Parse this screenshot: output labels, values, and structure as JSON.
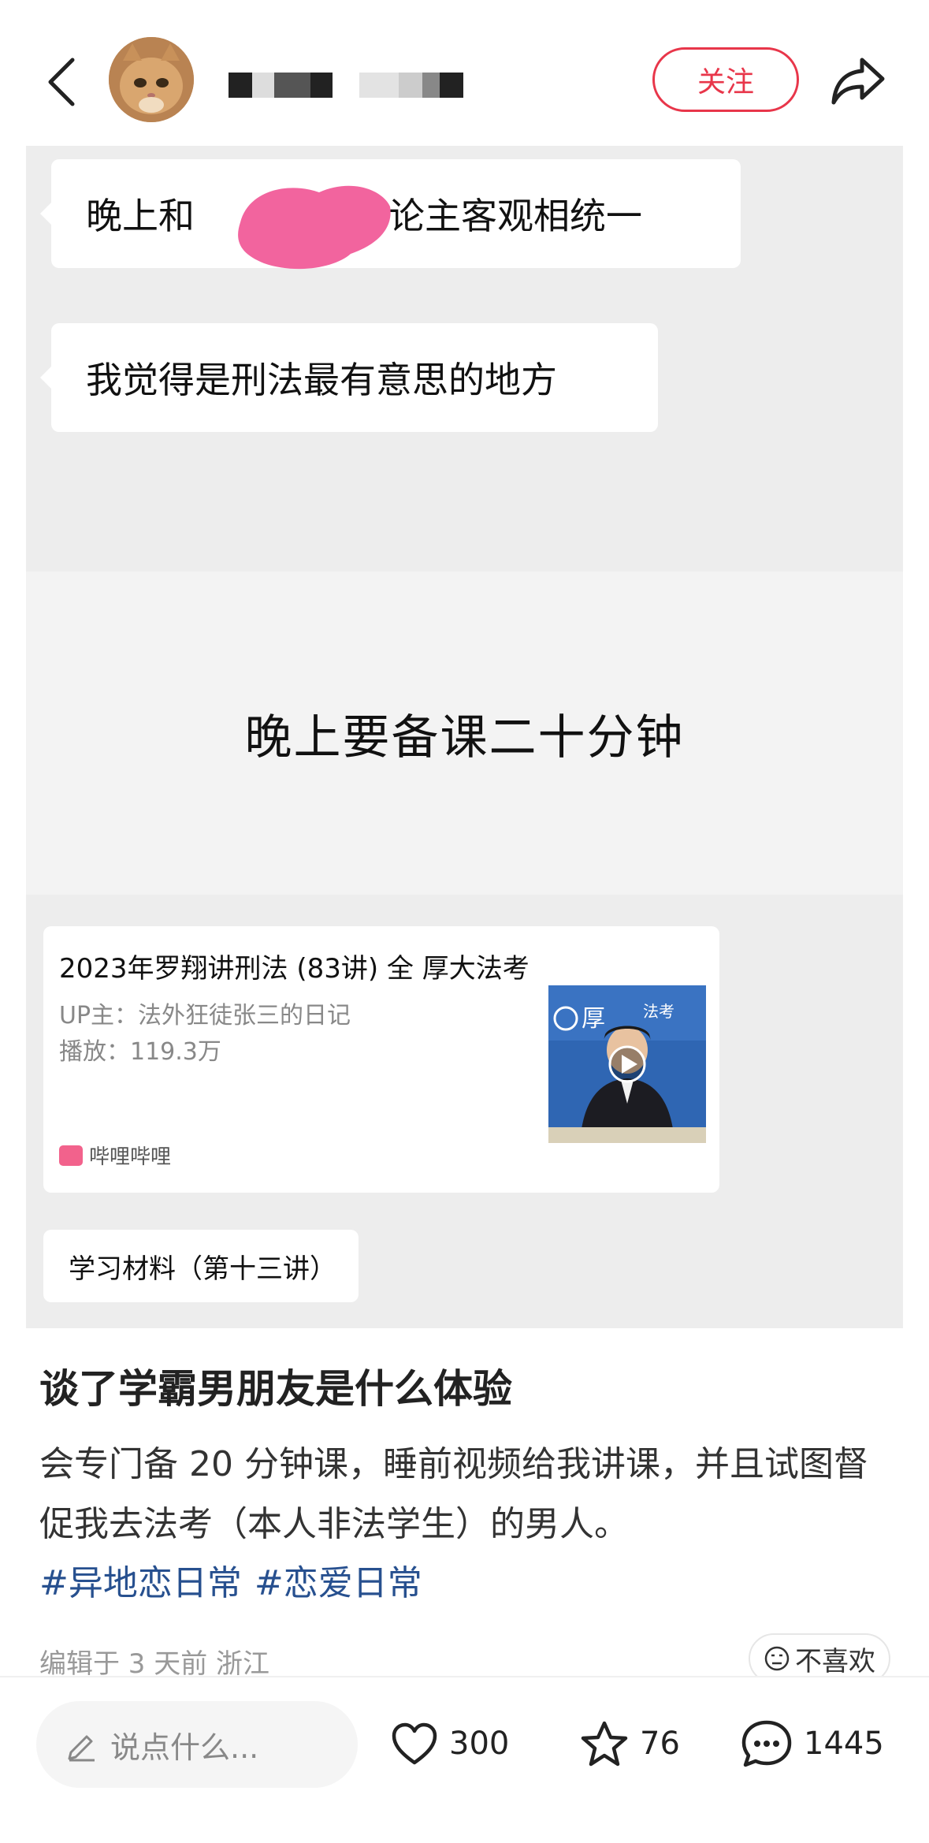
{
  "header": {
    "follow_label": "关注"
  },
  "image": {
    "bubble1_pre": "晚上和",
    "bubble1_post": "讨论主客观相统一",
    "bubble2": "我觉得是刑法最有意思的地方",
    "slide_text": "晚上要备课二十分钟",
    "card": {
      "title": "2023年罗翔讲刑法 (83讲) 全 厚大法考",
      "up": "UP主：法外狂徒张三的日记",
      "plays": "播放：119.3万",
      "brand": "哔哩哔哩",
      "thumb_label": "法考"
    },
    "tag": "学习材料（第十三讲）"
  },
  "post": {
    "title": "谈了学霸男朋友是什么体验",
    "body": "会专门备 20 分钟课，睡前视频给我讲课，并且试图督促我去法考（本人非法学生）的男人。",
    "hashtags": [
      "#异地恋日常",
      "#恋爱日常"
    ],
    "meta": "编辑于 3 天前 浙江",
    "dislike_label": "不喜欢"
  },
  "bottom": {
    "comment_placeholder": "说点什么...",
    "likes": "300",
    "stars": "76",
    "comments": "1445"
  },
  "colors": {
    "accent": "#e8364a",
    "hashtag": "#27508f",
    "image_bg": "#ededed"
  },
  "icons": [
    "back-arrow-icon",
    "share-icon",
    "heart-icon",
    "star-icon",
    "comment-icon",
    "pencil-icon",
    "neutral-face-icon",
    "bilibili-icon",
    "play-icon"
  ]
}
